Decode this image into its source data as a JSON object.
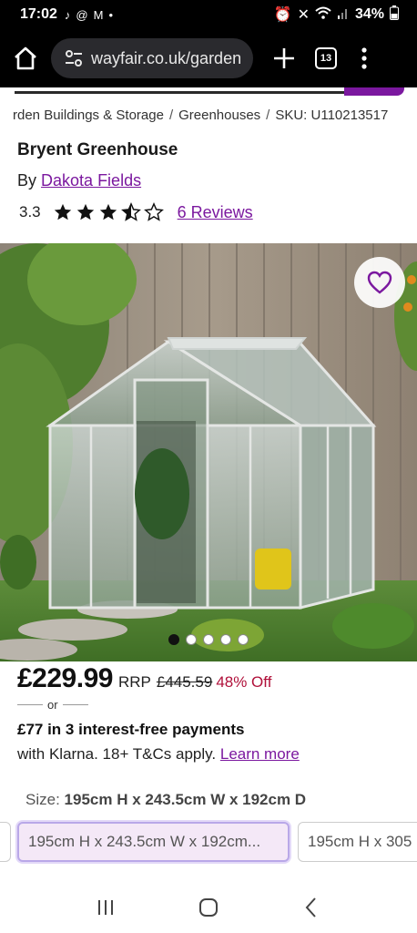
{
  "status_bar": {
    "time": "17:02",
    "notification_icons": [
      "tiktok-icon",
      "threads-icon",
      "gmail-icon",
      "dot-icon"
    ],
    "battery": "34%",
    "system_icons": [
      "alarm-icon",
      "mute-icon",
      "wifi-icon",
      "signal-icon",
      "battery-icon"
    ]
  },
  "browser": {
    "url": "wayfair.co.uk/garden",
    "tab_count": "13"
  },
  "breadcrumb": {
    "items": [
      "rden Buildings & Storage",
      "Greenhouses",
      "SKU: U110213517"
    ],
    "separator": "/"
  },
  "product": {
    "title": "Bryent Greenhouse",
    "by_label": "By",
    "brand": "Dakota Fields",
    "rating": "3.3",
    "stars_filled": 3.5,
    "stars_total": 5,
    "reviews_link": "6 Reviews"
  },
  "gallery": {
    "image_count": 5,
    "active_index": 0
  },
  "pricing": {
    "price": "£229.99",
    "rrp_label": "RRP",
    "rrp": "£445.59",
    "discount": "48% Off",
    "or": "or",
    "installments": "£77 in 3 interest-free payments",
    "klarna_text": "with Klarna. 18+ T&Cs apply.",
    "learn_more": "Learn more"
  },
  "size": {
    "label": "Size:",
    "selected": "195cm H x 243.5cm W x 192cm D",
    "options": [
      "195cm H x 243.5cm W x 192cm...",
      "195cm H x 305"
    ]
  },
  "colors": {
    "accent": "#7b189f",
    "discount": "#b0103a",
    "selected_bg": "#f4e8f7"
  }
}
